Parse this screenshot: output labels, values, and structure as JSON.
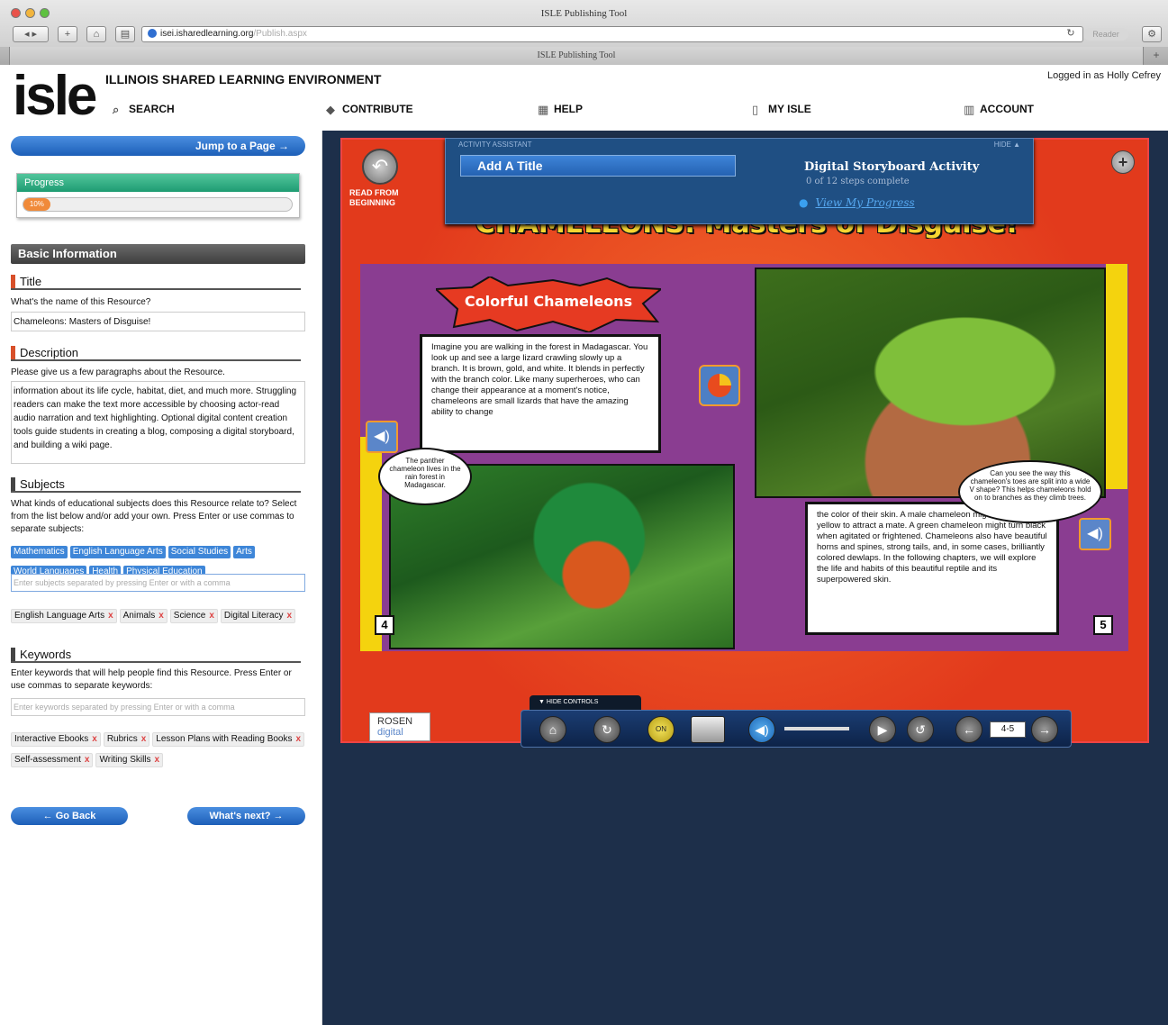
{
  "browser": {
    "window_title": "ISLE Publishing Tool",
    "url_host": "isei.isharedlearning.org",
    "url_path": "/Publish.aspx",
    "tab_title": "ISLE Publishing Tool",
    "reader_label": "Reader",
    "tab_add": "+"
  },
  "header": {
    "logo": "isle",
    "site_title": "ILLINOIS SHARED LEARNING ENVIRONMENT",
    "logged_in": "Logged in as Holly Cefrey",
    "nav": {
      "search": "SEARCH",
      "contribute": "CONTRIBUTE",
      "help": "HELP",
      "my_isle": "MY ISLE",
      "account": "ACCOUNT"
    }
  },
  "left_panel": {
    "jump_button": "Jump to a Page →",
    "progress_label": "Progress",
    "progress_value": 0.1,
    "progress_text": "10%",
    "basic_info": "Basic Information",
    "title": {
      "heading": "Title",
      "prompt": "What's the name of this Resource?",
      "value": "Chameleons: Masters of Disguise!"
    },
    "description": {
      "heading": "Description",
      "prompt": "Please give us a few paragraphs about the Resource.",
      "value": "information about its life cycle, habitat, diet, and much more. Struggling readers can make the text more accessible by choosing actor-read audio narration and text highlighting. Optional digital content creation tools guide students in creating a blog, composing a digital storyboard, and building a wiki page."
    },
    "subjects": {
      "heading": "Subjects",
      "prompt": "What kinds of educational subjects does this Resource relate to? Select from the list below and/or add your own. Press Enter or use commas to separate subjects:",
      "suggested": [
        "Mathematics",
        "English Language Arts",
        "Social Studies",
        "Arts",
        "World Languages",
        "Health",
        "Physical Education"
      ],
      "placeholder": "Enter subjects separated by pressing Enter or with a comma",
      "selected": [
        "English Language Arts",
        "Animals",
        "Science",
        "Digital Literacy"
      ]
    },
    "keywords": {
      "heading": "Keywords",
      "prompt": "Enter keywords that will help people find this Resource. Press Enter or use commas to separate keywords:",
      "placeholder": "Enter keywords separated by pressing Enter or with a comma",
      "selected": [
        "Interactive Ebooks",
        "Rubrics",
        "Lesson Plans with Reading Books",
        "Self-assessment",
        "Writing Skills"
      ]
    },
    "remove_glyph": "x",
    "back_button": "← Go Back",
    "next_button": "What's next? →"
  },
  "viewer": {
    "activity_label": "ACTIVITY ASSISTANT",
    "hide_label": "HIDE ▲",
    "add_title": "Add A Title",
    "activity_title": "Digital Storyboard Activity",
    "activity_steps": "0 of 12 steps complete",
    "progress_link": "View My Progress",
    "read_from_beginning": "READ FROM BEGINNING",
    "book_title": "CHAMELEONS: Masters of Disguise!",
    "chapter_title": "Colorful Chameleons",
    "page_left_text": "Imagine you are walking in the forest in Madagascar. You look up and see a large lizard crawling slowly up a branch. It is brown, gold, and white. It blends in perfectly with the branch color. Like many superheroes, who can change their appearance at a moment's notice, chameleons are small lizards that have the amazing ability to change",
    "caption_panther": "The panther chameleon lives in the rain forest in Madagascar.",
    "caption_toes": "Can you see the way this chameleon's toes are split into a wide V shape? This helps chameleons hold on to branches as they climb trees.",
    "page_right_text": "the color of their skin. A male chameleon might turn his lips yellow to attract a mate. A green chameleon might turn black when agitated or frightened. Chameleons also have beautiful horns and spines, strong tails, and, in some cases, brilliantly colored dewlaps. In the following chapters, we will explore the life and habits of this beautiful reptile and its superpowered skin.",
    "page_left_num": "4",
    "page_right_num": "5",
    "hide_controls": "▼ HIDE CONTROLS",
    "page_field": "4-5",
    "rosen_line1": "ROSEN",
    "rosen_line2": "digital",
    "ctrl_on": "ON"
  }
}
